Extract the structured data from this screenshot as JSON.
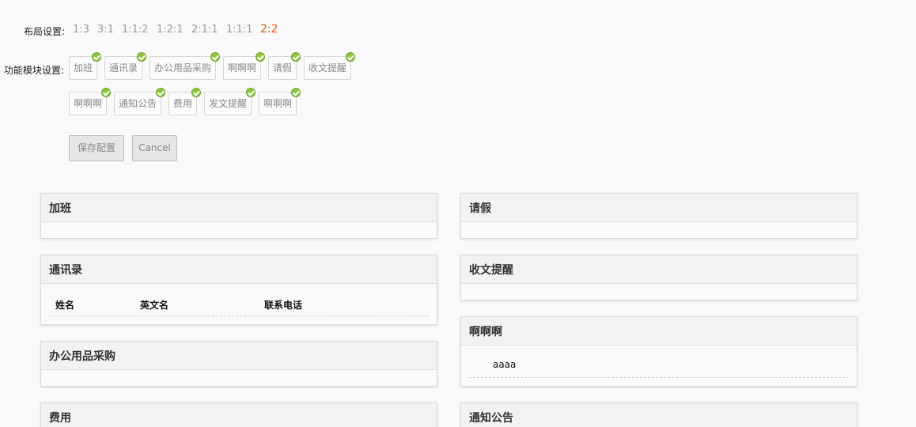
{
  "layout_setting": {
    "label": "布局设置:",
    "options": [
      "1:3",
      "3:1",
      "1:1:2",
      "1:2:1",
      "2:1:1",
      "1:1:1",
      "2:2"
    ],
    "active": "2:2"
  },
  "module_setting": {
    "label": "功能模块设置:",
    "row1": [
      "加班",
      "通讯录",
      "办公用品采购",
      "啊啊啊",
      "请假",
      "收文提醒"
    ],
    "row2": [
      "啊啊啊",
      "通知公告",
      "费用",
      "发文提醒",
      "啊啊啊"
    ]
  },
  "buttons": {
    "save": "保存配置",
    "cancel": "Cancel"
  },
  "panels": {
    "overtime": {
      "title": "加班"
    },
    "contacts": {
      "title": "通讯录",
      "columns": [
        "姓名",
        "英文名",
        "联系电话"
      ]
    },
    "office_supplies": {
      "title": "办公用品采购"
    },
    "expense": {
      "title": "费用"
    },
    "leave": {
      "title": "请假"
    },
    "incoming_reminder": {
      "title": "收文提醒"
    },
    "aaa": {
      "title": "啊啊啊",
      "item": "aaaa"
    },
    "notice": {
      "title": "通知公告"
    }
  },
  "colors": {
    "active": "#e25a0e",
    "check": "#8cc63f"
  }
}
